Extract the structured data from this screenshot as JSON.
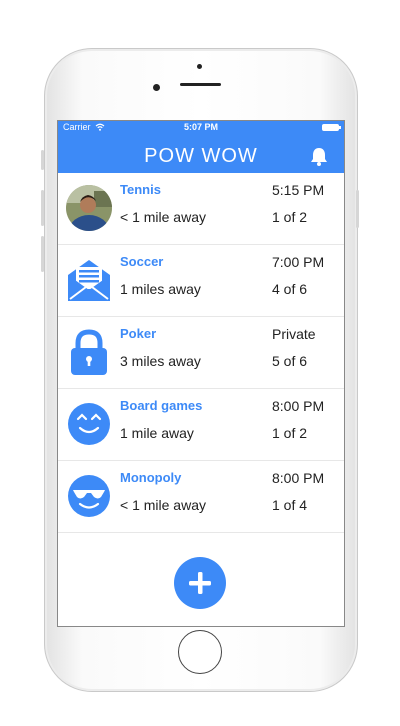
{
  "status_bar": {
    "carrier": "Carrier",
    "time": "5:07 PM"
  },
  "header": {
    "title": "POW WOW",
    "bell_icon": "bell-icon"
  },
  "events": [
    {
      "title": "Tennis",
      "distance": "< 1 mile away",
      "time": "5:15 PM",
      "count": "1 of 2",
      "icon": "user-avatar"
    },
    {
      "title": "Soccer",
      "distance": "1 miles away",
      "time": "7:00 PM",
      "count": "4 of 6",
      "icon": "envelope-icon"
    },
    {
      "title": "Poker",
      "distance": "3 miles away",
      "time": "Private",
      "count": "5 of 6",
      "icon": "lock-icon"
    },
    {
      "title": "Board games",
      "distance": "1 mile away",
      "time": "8:00 PM",
      "count": "1 of 2",
      "icon": "smiley-icon"
    },
    {
      "title": "Monopoly",
      "distance": "< 1 mile away",
      "time": "8:00 PM",
      "count": "1 of 4",
      "icon": "sunglasses-smiley-icon"
    }
  ],
  "add_button": {
    "icon": "plus-icon"
  },
  "colors": {
    "accent": "#3d8af7",
    "text": "#222222",
    "divider": "#e7e7e7"
  }
}
